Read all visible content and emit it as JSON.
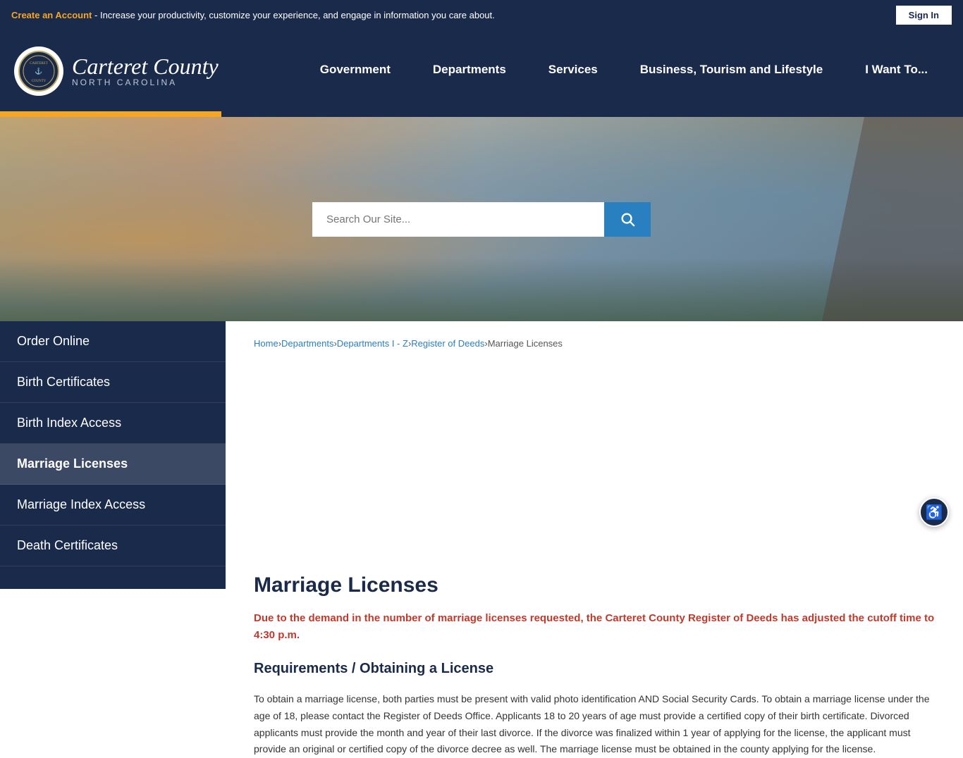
{
  "topbar": {
    "create_account_label": "Create an Account",
    "topbar_message": " - Increase your productivity, customize your experience, and engage in information you care about.",
    "sign_in_label": "Sign In"
  },
  "header": {
    "logo_county": "Carteret County",
    "logo_state": "NORTH CAROLINA",
    "nav": [
      {
        "label": "Government",
        "id": "government"
      },
      {
        "label": "Departments",
        "id": "departments"
      },
      {
        "label": "Services",
        "id": "services"
      },
      {
        "label": "Business, Tourism and Lifestyle",
        "id": "business"
      },
      {
        "label": "I Want To...",
        "id": "i-want-to"
      }
    ]
  },
  "hero": {
    "search_placeholder": "Search Our Site..."
  },
  "sidebar": {
    "items": [
      {
        "label": "Order Online",
        "id": "order-online",
        "active": false
      },
      {
        "label": "Birth Certificates",
        "id": "birth-certificates",
        "active": false
      },
      {
        "label": "Birth Index Access",
        "id": "birth-index-access",
        "active": false
      },
      {
        "label": "Marriage Licenses",
        "id": "marriage-licenses",
        "active": true
      },
      {
        "label": "Marriage Index Access",
        "id": "marriage-index-access",
        "active": false
      },
      {
        "label": "Death Certificates",
        "id": "death-certificates",
        "active": false
      }
    ]
  },
  "breadcrumb": {
    "items": [
      {
        "label": "Home",
        "href": "#"
      },
      {
        "label": "Departments",
        "href": "#"
      },
      {
        "label": "Departments I - Z",
        "href": "#"
      },
      {
        "label": "Register of Deeds",
        "href": "#"
      },
      {
        "label": "Marriage Licenses",
        "href": null
      }
    ]
  },
  "content": {
    "page_title": "Marriage Licenses",
    "alert": "Due to the demand in the number of marriage licenses requested, the Carteret County Register of Deeds has adjusted the cutoff time to 4:30 p.m.",
    "section_title": "Requirements / Obtaining a License",
    "body_text": "To obtain a marriage license, both parties must be present with valid photo identification AND Social Security Cards. To obtain a marriage license under the age of 18, please contact the Register of Deeds Office. Applicants 18 to 20 years of age must provide a certified copy of their birth certificate. Divorced applicants must provide the month and year of their last divorce. If the divorce was finalized within 1 year of applying for the license, the applicant must provide an original or certified copy of the divorce decree as well. The marriage license must be obtained in the county applying for the license."
  },
  "accessibility": {
    "label": "♿"
  }
}
